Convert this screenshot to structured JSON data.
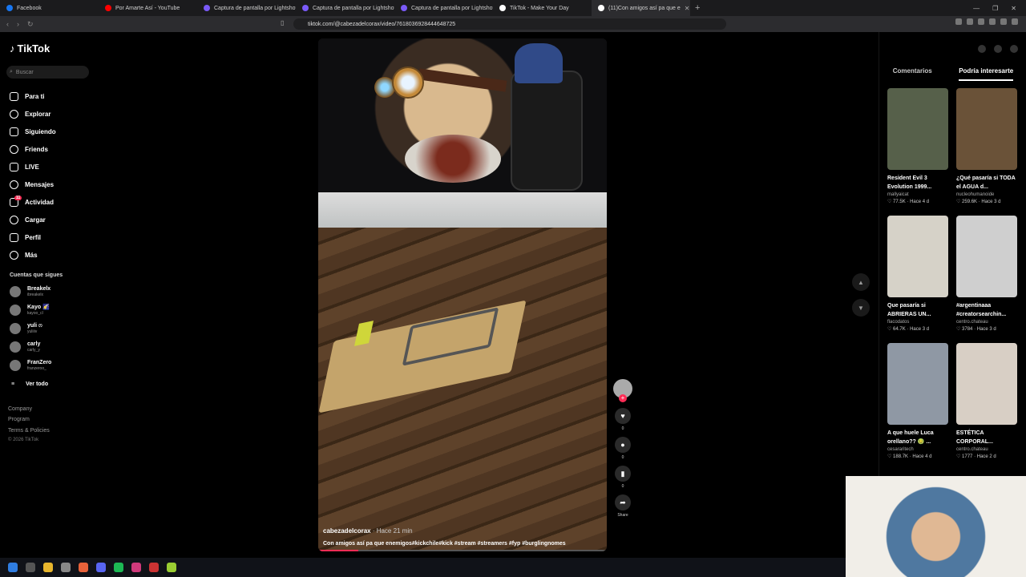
{
  "browser": {
    "tabs": [
      {
        "title": "Facebook",
        "color": "#1877f2"
      },
      {
        "title": "Por Amarte Así - YouTube",
        "color": "#ff0000"
      },
      {
        "title": "Captura de pantalla por Lightshot",
        "color": "#7a5af8"
      },
      {
        "title": "Captura de pantalla por Lightshot",
        "color": "#7a5af8"
      },
      {
        "title": "Captura de pantalla por Lightshot",
        "color": "#7a5af8"
      },
      {
        "title": "TikTok - Make Your Day",
        "color": "#ffffff"
      },
      {
        "title": "(11)Con amigos así pa que e",
        "color": "#ffffff",
        "active": true
      }
    ],
    "url": "tiktok.com/@cabezadelcorax/video/7618036928444648725"
  },
  "sidebar": {
    "logo": "TikTok",
    "search_placeholder": "Buscar",
    "nav": [
      {
        "label": "Para ti",
        "icon": "home-icon"
      },
      {
        "label": "Explorar",
        "icon": "compass-icon"
      },
      {
        "label": "Siguiendo",
        "icon": "following-icon"
      },
      {
        "label": "Friends",
        "icon": "friends-icon"
      },
      {
        "label": "LIVE",
        "icon": "live-icon"
      },
      {
        "label": "Mensajes",
        "icon": "messages-icon"
      },
      {
        "label": "Actividad",
        "icon": "activity-icon",
        "badge": "11"
      },
      {
        "label": "Cargar",
        "icon": "upload-icon"
      },
      {
        "label": "Perfil",
        "icon": "profile-icon"
      },
      {
        "label": "Más",
        "icon": "more-icon"
      }
    ],
    "following_title": "Cuentas que sigues",
    "following": [
      {
        "name": "Breakelx",
        "handle": "ibreakelx"
      },
      {
        "name": "Kayo 🌠",
        "handle": "kayoo_cl"
      },
      {
        "name": "yuli ෆ",
        "handle": "yuliiiv"
      },
      {
        "name": "carly",
        "handle": "carly_y"
      },
      {
        "name": "FranZero",
        "handle": "franzeroo_"
      }
    ],
    "see_all": "Ver todo",
    "footer": [
      "Company",
      "Program",
      "Terms & Policies"
    ],
    "copyright": "© 2026 TikTok"
  },
  "video": {
    "author": "cabezadelcorax",
    "time": " · Hace 21 min",
    "description": "Con amigos así pa que enemigos#kickchile#kick #stream #streamers #fyp #burglingnomes",
    "progress_pct": 14
  },
  "actions": {
    "likes": "0",
    "comments": "0",
    "saves": "0",
    "share": "Share"
  },
  "right_panel": {
    "tabs": [
      {
        "label": "Comentarios"
      },
      {
        "label": "Podría interesarte",
        "active": true
      }
    ],
    "cards": [
      {
        "title": "Resident Evil 3 Evolution 1999...",
        "author": "mallyaicat",
        "likes": "77.5K",
        "ago": "Hace 4 d",
        "color": "#56604a"
      },
      {
        "title": "¿Qué pasaría si TODA el AGUA d...",
        "author": "nucleohumanoide",
        "likes": "259.6K",
        "ago": "Hace 3 d",
        "color": "#6a5238"
      },
      {
        "title": "Que pasaría si ABRIERAS UN...",
        "author": "flacodatos",
        "likes": "64.7K",
        "ago": "Hace 3 d",
        "color": "#d6d2c8"
      },
      {
        "title": "#argentinaaa #creatorsearchin...",
        "author": "centro.chateau",
        "likes": "3784",
        "ago": "Hace 3 d",
        "color": "#cfcfcf"
      },
      {
        "title": "A que huele Luca orellano?? 🤢 ...",
        "author": "cesararitech",
        "likes": "188.7K",
        "ago": "Hace 4 d",
        "color": "#8f98a4"
      },
      {
        "title": "ESTÉTICA CORPORAL...",
        "author": "centro.chateau",
        "likes": "1777",
        "ago": "Hace 2 d",
        "color": "#d8cfc5"
      }
    ]
  }
}
